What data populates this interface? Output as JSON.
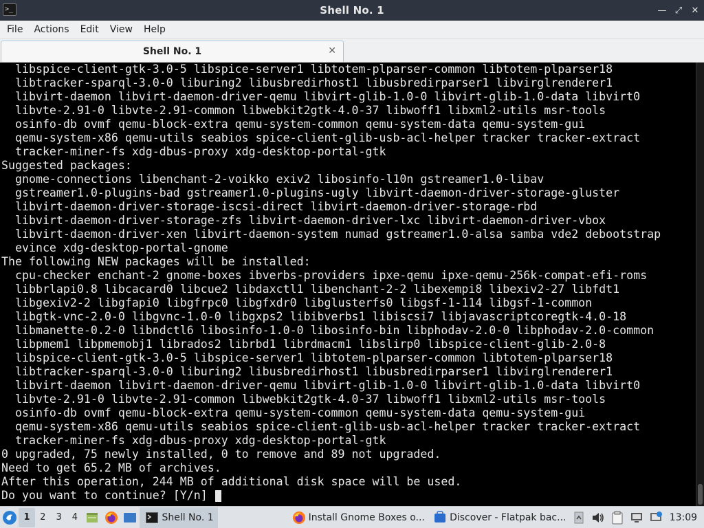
{
  "window": {
    "title": "Shell No. 1",
    "controls": {
      "minimize": "—",
      "maximize": "⤢",
      "close": "✕"
    }
  },
  "menu": [
    "File",
    "Actions",
    "Edit",
    "View",
    "Help"
  ],
  "tab": {
    "label": "Shell No. 1",
    "close": "✕"
  },
  "terminal": {
    "lines": [
      "  libspice-client-gtk-3.0-5 libspice-server1 libtotem-plparser-common libtotem-plparser18",
      "  libtracker-sparql-3.0-0 liburing2 libusbredirhost1 libusbredirparser1 libvirglrenderer1",
      "  libvirt-daemon libvirt-daemon-driver-qemu libvirt-glib-1.0-0 libvirt-glib-1.0-data libvirt0",
      "  libvte-2.91-0 libvte-2.91-common libwebkit2gtk-4.0-37 libwoff1 libxml2-utils msr-tools",
      "  osinfo-db ovmf qemu-block-extra qemu-system-common qemu-system-data qemu-system-gui",
      "  qemu-system-x86 qemu-utils seabios spice-client-glib-usb-acl-helper tracker tracker-extract",
      "  tracker-miner-fs xdg-dbus-proxy xdg-desktop-portal-gtk",
      "Suggested packages:",
      "  gnome-connections libenchant-2-voikko exiv2 libosinfo-l10n gstreamer1.0-libav",
      "  gstreamer1.0-plugins-bad gstreamer1.0-plugins-ugly libvirt-daemon-driver-storage-gluster",
      "  libvirt-daemon-driver-storage-iscsi-direct libvirt-daemon-driver-storage-rbd",
      "  libvirt-daemon-driver-storage-zfs libvirt-daemon-driver-lxc libvirt-daemon-driver-vbox",
      "  libvirt-daemon-driver-xen libvirt-daemon-system numad gstreamer1.0-alsa samba vde2 debootstrap",
      "  evince xdg-desktop-portal-gnome",
      "The following NEW packages will be installed:",
      "  cpu-checker enchant-2 gnome-boxes ibverbs-providers ipxe-qemu ipxe-qemu-256k-compat-efi-roms",
      "  libbrlapi0.8 libcacard0 libcue2 libdaxctl1 libenchant-2-2 libexempi8 libexiv2-27 libfdt1",
      "  libgexiv2-2 libgfapi0 libgfrpc0 libgfxdr0 libglusterfs0 libgsf-1-114 libgsf-1-common",
      "  libgtk-vnc-2.0-0 libgvnc-1.0-0 libgxps2 libibverbs1 libiscsi7 libjavascriptcoregtk-4.0-18",
      "  libmanette-0.2-0 libndctl6 libosinfo-1.0-0 libosinfo-bin libphodav-2.0-0 libphodav-2.0-common",
      "  libpmem1 libpmemobj1 librados2 librbd1 librdmacm1 libslirp0 libspice-client-glib-2.0-8",
      "  libspice-client-gtk-3.0-5 libspice-server1 libtotem-plparser-common libtotem-plparser18",
      "  libtracker-sparql-3.0-0 liburing2 libusbredirhost1 libusbredirparser1 libvirglrenderer1",
      "  libvirt-daemon libvirt-daemon-driver-qemu libvirt-glib-1.0-0 libvirt-glib-1.0-data libvirt0",
      "  libvte-2.91-0 libvte-2.91-common libwebkit2gtk-4.0-37 libwoff1 libxml2-utils msr-tools",
      "  osinfo-db ovmf qemu-block-extra qemu-system-common qemu-system-data qemu-system-gui",
      "  qemu-system-x86 qemu-utils seabios spice-client-glib-usb-acl-helper tracker tracker-extract",
      "  tracker-miner-fs xdg-dbus-proxy xdg-desktop-portal-gtk",
      "0 upgraded, 75 newly installed, 0 to remove and 89 not upgraded.",
      "Need to get 65.2 MB of archives.",
      "After this operation, 244 MB of additional disk space will be used."
    ],
    "prompt": "Do you want to continue? [Y/n] "
  },
  "taskbar": {
    "desktops": [
      "1",
      "2",
      "3",
      "4"
    ],
    "tasks": [
      {
        "label": "Shell No. 1",
        "icon": "terminal-icon"
      },
      {
        "label": "Install Gnome Boxes o...",
        "icon": "firefox-icon"
      },
      {
        "label": "Discover - Flatpak bac...",
        "icon": "discover-icon"
      }
    ],
    "clock": "13:09"
  },
  "colors": {
    "terminal_bg": "#000000",
    "terminal_fg": "#e6e6e6",
    "titlebar_bg": "#2e3440",
    "menubar_bg": "#eff0f1",
    "taskbar_bg": "#dfe3e8"
  }
}
